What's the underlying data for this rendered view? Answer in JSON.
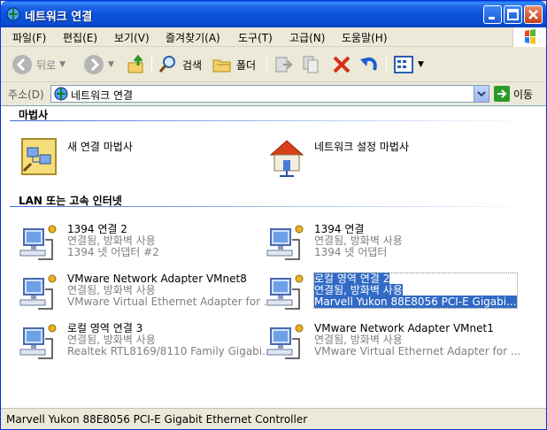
{
  "window": {
    "title": "네트워크 연결"
  },
  "menu": [
    "파일(F)",
    "편집(E)",
    "보기(V)",
    "즐겨찾기(A)",
    "도구(T)",
    "고급(N)",
    "도움말(H)"
  ],
  "toolbar": {
    "back": "뒤로",
    "search": "검색",
    "folders": "폴더"
  },
  "address": {
    "label": "주소(D)",
    "value": "네트워크 연결",
    "go": "이동"
  },
  "groups": {
    "wizard": "마법사",
    "lan": "LAN 또는 고속 인터넷"
  },
  "wizards": [
    {
      "label": "새 연결 마법사",
      "icon": "new-connection-wizard-icon"
    },
    {
      "label": "네트워크 설정 마법사",
      "icon": "network-setup-wizard-icon"
    }
  ],
  "connections": [
    {
      "name": "1394 연결 2",
      "status": "연결됨, 방화벽 사용",
      "device": "1394 넷 어댑터 #2"
    },
    {
      "name": "1394 연결",
      "status": "연결됨, 방화벽 사용",
      "device": "1394 넷 어댑터"
    },
    {
      "name": "VMware Network Adapter VMnet8",
      "status": "연결됨, 방화벽 사용",
      "device": "VMware Virtual Ethernet Adapter for ..."
    },
    {
      "name": "로컬 영역 연결 2",
      "status": "연결됨, 방화벽 사용",
      "device": "Marvell Yukon 88E8056 PCI-E Gigabi...",
      "selected": true
    },
    {
      "name": "로컬 영역 연결 3",
      "status": "연결됨, 방화벽 사용",
      "device": "Realtek RTL8169/8110 Family Gigabi..."
    },
    {
      "name": "VMware Network Adapter VMnet1",
      "status": "연결됨, 방화벽 사용",
      "device": "VMware Virtual Ethernet Adapter for ..."
    }
  ],
  "statusbar": {
    "text": "Marvell Yukon 88E8056 PCI-E Gigabit Ethernet Controller"
  },
  "colors": {
    "titlebar": "#0a4ed6",
    "selection": "#316ac5",
    "accent": "#3f6dd4"
  }
}
